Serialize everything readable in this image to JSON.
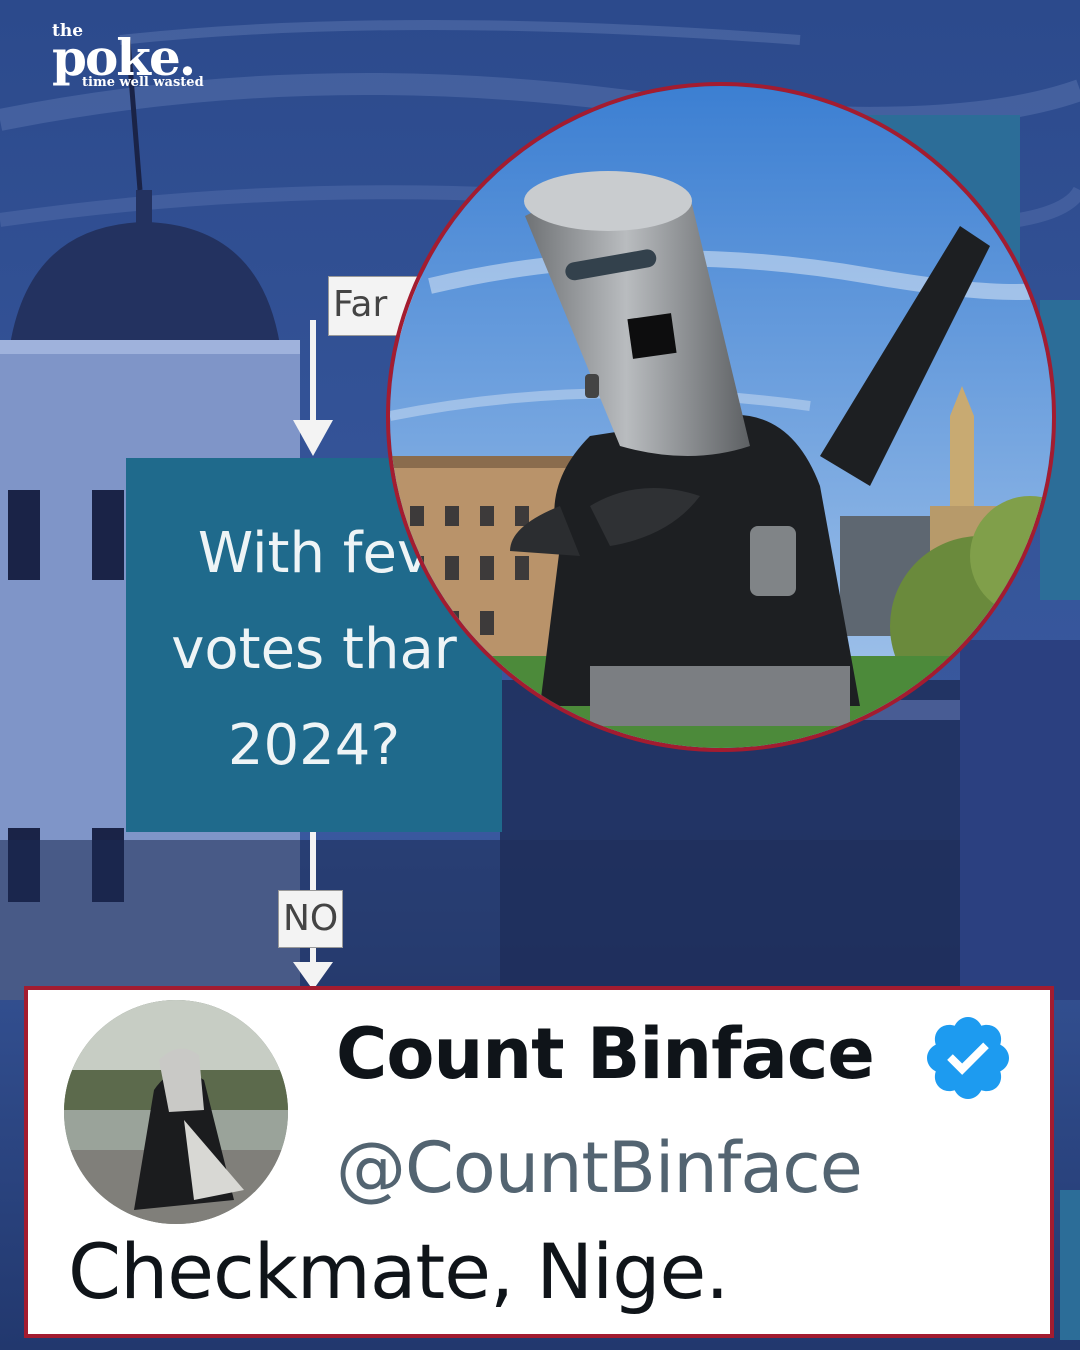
{
  "brand": {
    "the": "the",
    "poke": "poke.",
    "tagline": "time well wasted"
  },
  "flowchart": {
    "top_label": "Far",
    "question_lines": [
      "With fev",
      "votes thar",
      "2024?"
    ],
    "answer_label": "NO"
  },
  "photo": {
    "subject": "Count Binface costume"
  },
  "tweet": {
    "name": "Count Binface",
    "handle": "@CountBinface",
    "text": "Checkmate, Nige.",
    "verified_icon": "verified-badge-icon"
  },
  "colors": {
    "frame_red": "#a31c30",
    "flow_teal": "#1f6a8c",
    "verified_blue": "#1d9bf0",
    "sky_blue": "#2f4f8f"
  }
}
